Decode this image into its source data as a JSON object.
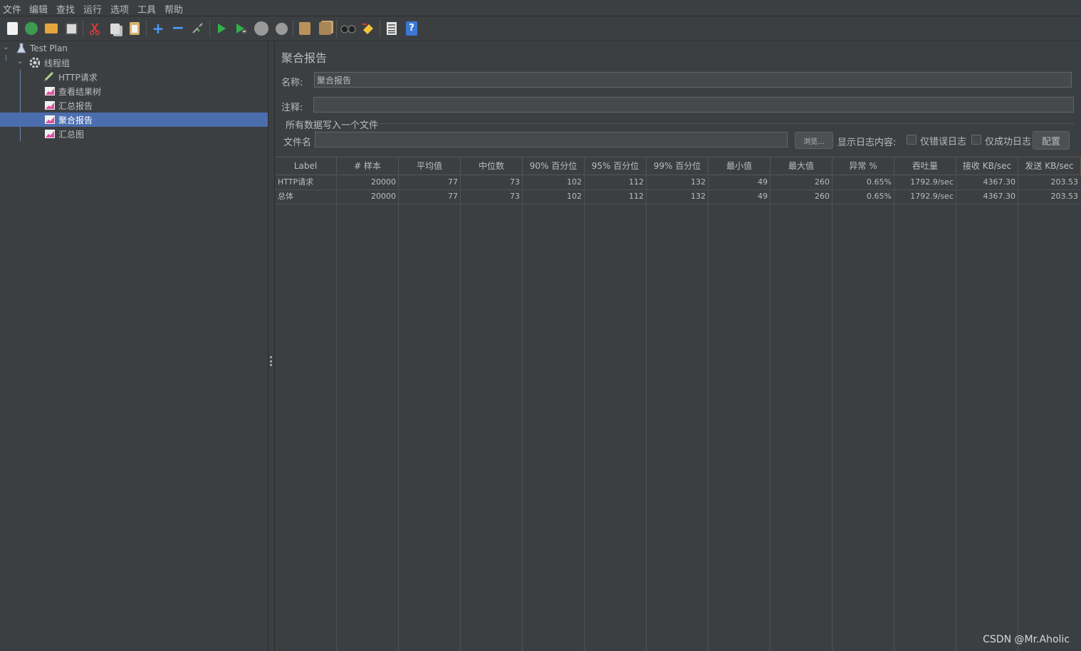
{
  "menu": [
    "文件",
    "编辑",
    "查找",
    "运行",
    "选项",
    "工具",
    "帮助"
  ],
  "toolbar_icons": [
    "new-icon",
    "templates-icon",
    "open-icon",
    "save-icon",
    "cut-icon",
    "copy-icon",
    "paste-icon",
    "expand-icon",
    "collapse-icon",
    "toggle-icon",
    "start-icon",
    "start-no-pause-icon",
    "stop-icon",
    "shutdown-icon",
    "clear-icon",
    "clear-all-icon",
    "search-icon",
    "reset-search-icon",
    "function-helper-icon",
    "help-icon"
  ],
  "tree": {
    "items": [
      {
        "label": "Test Plan"
      },
      {
        "label": "线程组"
      },
      {
        "label": "HTTP请求"
      },
      {
        "label": "查看结果树"
      },
      {
        "label": "汇总报告"
      },
      {
        "label": "聚合报告"
      },
      {
        "label": "汇总图"
      }
    ]
  },
  "panel": {
    "title": "聚合报告",
    "name_label": "名称:",
    "name_value": "聚合报告",
    "comment_label": "注释:",
    "comment_value": "",
    "group_title": "所有数据写入一个文件",
    "filename_label": "文件名",
    "filename_value": "",
    "browse_label": "浏览...",
    "log_label": "显示日志内容:",
    "errors_only": "仅错误日志",
    "success_only": "仅成功日志",
    "config_label": "配置"
  },
  "table": {
    "headers": [
      "Label",
      "# 样本",
      "平均值",
      "中位数",
      "90% 百分位",
      "95% 百分位",
      "99% 百分位",
      "最小值",
      "最大值",
      "异常 %",
      "吞吐量",
      "接收 KB/sec",
      "发送 KB/sec"
    ],
    "rows": [
      [
        "HTTP请求",
        "20000",
        "77",
        "73",
        "102",
        "112",
        "132",
        "49",
        "260",
        "0.65%",
        "1792.9/sec",
        "4367.30",
        "203.53"
      ],
      [
        "总体",
        "20000",
        "77",
        "73",
        "102",
        "112",
        "132",
        "49",
        "260",
        "0.65%",
        "1792.9/sec",
        "4367.30",
        "203.53"
      ]
    ]
  },
  "watermark": "CSDN @Mr.Aholic",
  "colors": {
    "background": "#3c3f41",
    "selection": "#4b6eaf",
    "text": "#bbbbbb"
  }
}
